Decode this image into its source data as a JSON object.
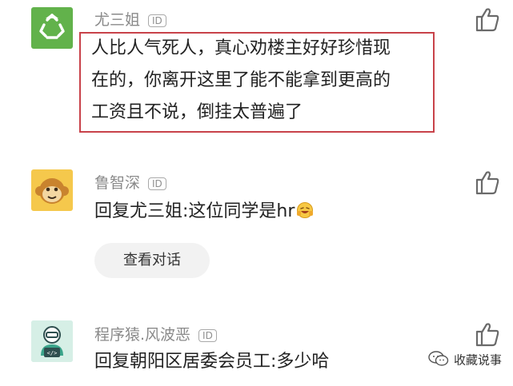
{
  "comments": [
    {
      "name": "尤三姐",
      "badge": "ID",
      "text_lines": [
        "人比人气死人，真心劝楼主好好珍惜现",
        "在的，你离开这里了能不能拿到更高的",
        "工资且不说，倒挂太普遍了"
      ],
      "avatar_icon": "recycle-icon",
      "avatar_color": "#62b24b"
    },
    {
      "name": "鲁智深",
      "badge": "ID",
      "reply": "回复尤三姐:这位同学是hr",
      "reply_emoji": "laughing-emoji-icon",
      "view_button": "查看对话",
      "avatar_icon": "monkey-face-icon",
      "avatar_color": "#f5c84c"
    },
    {
      "name": "程序猿.风波恶",
      "badge": "ID",
      "reply": "回复朝阳区居委会员工:多少哈",
      "avatar_icon": "programmer-code-icon",
      "avatar_color": "#bfe6d9"
    }
  ],
  "watermark": {
    "text": "收藏说事",
    "icon": "wechat-logo-icon"
  },
  "colors": {
    "highlight_border": "#c8424a",
    "name_gray": "#8a8a8a"
  }
}
